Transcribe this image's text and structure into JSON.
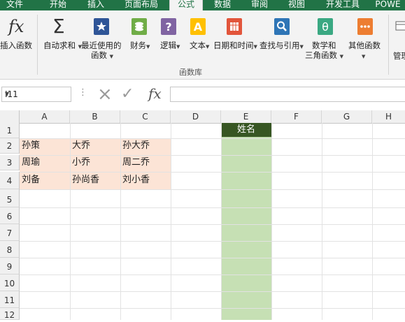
{
  "tabs": [
    {
      "label": "文件",
      "active": false
    },
    {
      "label": "开始",
      "active": false
    },
    {
      "label": "插入",
      "active": false
    },
    {
      "label": "页面布局",
      "active": false
    },
    {
      "label": "公式",
      "active": true
    },
    {
      "label": "数据",
      "active": false
    },
    {
      "label": "审阅",
      "active": false
    },
    {
      "label": "视图",
      "active": false
    },
    {
      "label": "开发工具",
      "active": false
    },
    {
      "label": "POWE",
      "active": false
    }
  ],
  "ribbon": {
    "insert_function": {
      "label": "插入函数",
      "icon": "fx-icon"
    },
    "autosum": {
      "label": "自动求和",
      "icon": "sigma-icon"
    },
    "recent": {
      "label1": "最近使用的",
      "label2": "函数",
      "icon": "star-book-icon"
    },
    "financial": {
      "label": "财务",
      "icon": "coins-book-icon"
    },
    "logical": {
      "label": "逻辑",
      "icon": "question-book-icon"
    },
    "text": {
      "label": "文本",
      "icon": "a-book-icon"
    },
    "datetime": {
      "label": "日期和时间",
      "icon": "calendar-book-icon"
    },
    "lookup": {
      "label": "查找与引用",
      "icon": "magnifier-book-icon"
    },
    "math": {
      "label1": "数学和",
      "label2": "三角函数",
      "icon": "theta-book-icon"
    },
    "more": {
      "label": "其他函数",
      "icon": "dots-book-icon"
    },
    "name_manager": {
      "label": "管理",
      "icon": "name-tag-icon"
    },
    "group_label": "函数库"
  },
  "formula_bar": {
    "name_box": "I11",
    "cancel_icon": "×",
    "enter_icon": "✓",
    "fx_icon": "fx",
    "value": ""
  },
  "columns": [
    "A",
    "B",
    "C",
    "D",
    "E",
    "F",
    "G",
    "H"
  ],
  "rows": [
    "1",
    "2",
    "3",
    "4",
    "5",
    "6",
    "7",
    "8",
    "9",
    "10",
    "11",
    "12"
  ],
  "cells": {
    "A2": "孙策",
    "B2": "大乔",
    "C2": "孙大乔",
    "A3": "周瑜",
    "B3": "小乔",
    "C3": "周二乔",
    "A4": "刘备",
    "B4": "孙尚香",
    "C4": "刘小香",
    "E1": "姓名"
  },
  "colors": {
    "accent": "#217346",
    "peach_fill": "#fce4d6",
    "green_fill": "#c6e0b4",
    "header_fill": "#375623"
  }
}
